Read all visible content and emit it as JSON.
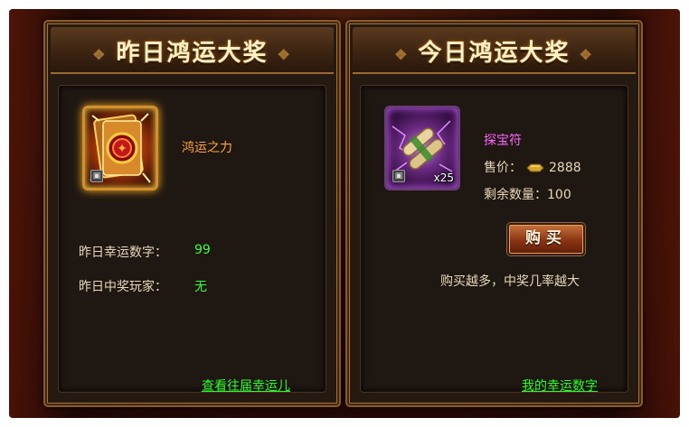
{
  "left_panel": {
    "title": "昨日鸿运大奖",
    "item_name": "鸿运之力",
    "lucky_number_label": "昨日幸运数字：",
    "lucky_number_value": "99",
    "winner_label": "昨日中奖玩家：",
    "winner_value": "无",
    "history_link": "查看往届幸运儿"
  },
  "right_panel": {
    "title": "今日鸿运大奖",
    "item_name": "探宝符",
    "item_quantity": "x25",
    "price_label": "售价：",
    "price_value": "2888",
    "remaining_label": "剩余数量：",
    "remaining_value": "100",
    "buy_button": "购买",
    "hint": "购买越多，中奖几率越大",
    "my_numbers_link": "我的幸运数字"
  },
  "colors": {
    "label": "#e8d8b8",
    "green": "#39ff39",
    "orange_item": "#ffa53a",
    "purple_item": "#ff66ff",
    "link": "#2cff2c"
  },
  "icons": {
    "left_item": "fortune-power-card-icon",
    "right_item": "treasure-scroll-icon",
    "lock": "lock-icon",
    "currency": "gold-ingot-icon"
  }
}
